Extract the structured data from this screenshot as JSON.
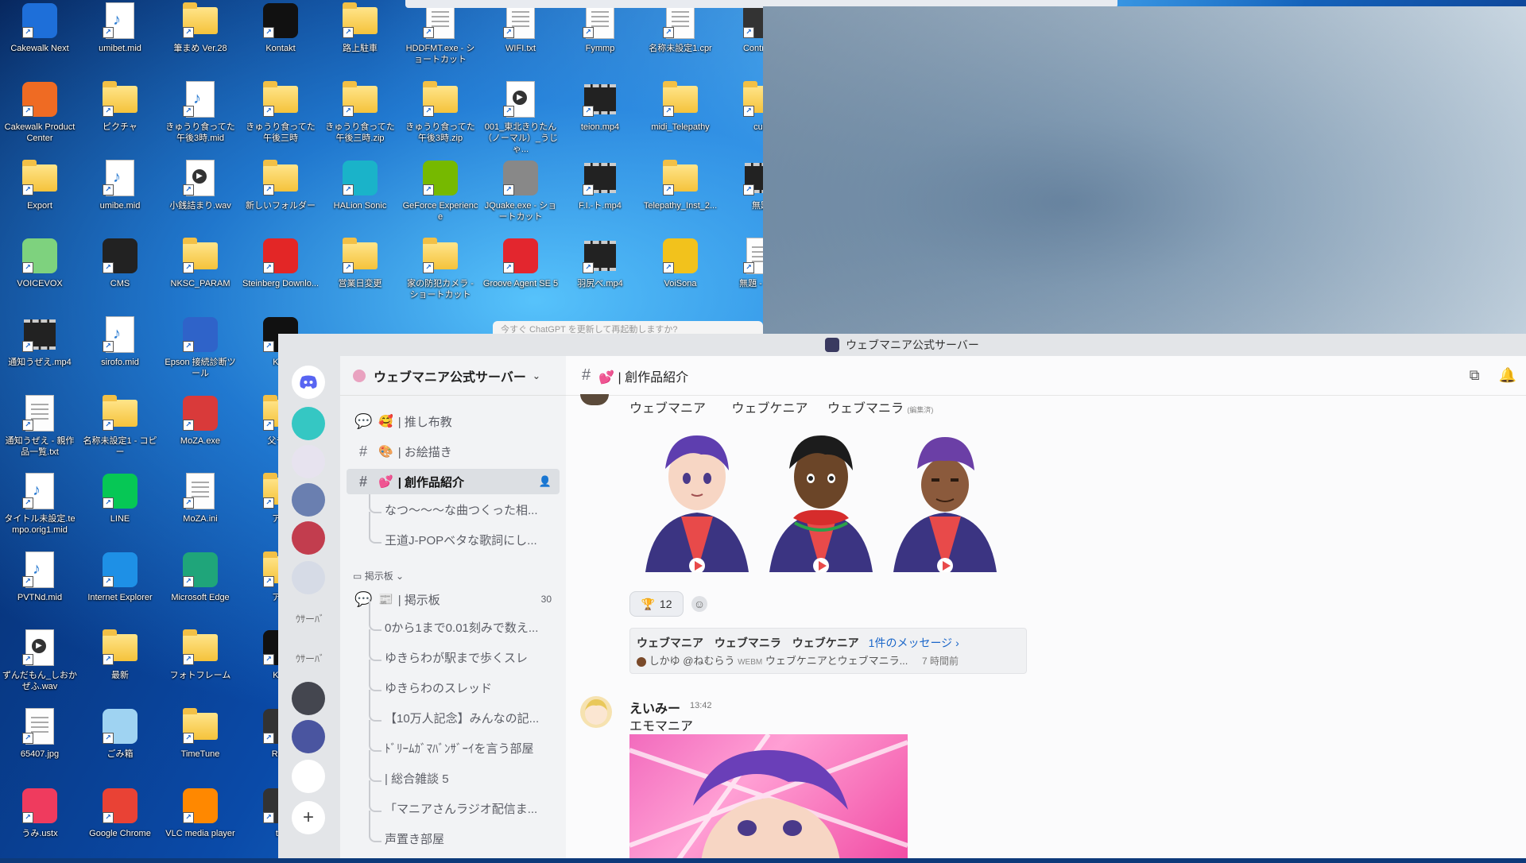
{
  "desktop": {
    "icons": [
      {
        "label": "Cakewalk Next",
        "kind": "app",
        "color": "#1e6fd9"
      },
      {
        "label": "umibet.mid",
        "kind": "midi"
      },
      {
        "label": "筆まめ Ver.28",
        "kind": "folder"
      },
      {
        "label": "Kontakt",
        "kind": "app",
        "color": "#111111"
      },
      {
        "label": "路上駐車",
        "kind": "folder"
      },
      {
        "label": "HDDFMT.exe - ショートカット",
        "kind": "doc"
      },
      {
        "label": "WIFI.txt",
        "kind": "doc"
      },
      {
        "label": "Fymmp",
        "kind": "doc"
      },
      {
        "label": "名称未設定1.cpr",
        "kind": "doc"
      },
      {
        "label": "Controlle",
        "kind": "app",
        "color": "#333333"
      },
      {
        "label": "Cakewalk Product Center",
        "kind": "app",
        "color": "#ef6b23"
      },
      {
        "label": "ピクチャ",
        "kind": "folder"
      },
      {
        "label": "きゅうり食ってた午後3時.mid",
        "kind": "midi"
      },
      {
        "label": "きゅうり食ってた午後三時",
        "kind": "folder"
      },
      {
        "label": "きゅうり食ってた午後三時.zip",
        "kind": "folder"
      },
      {
        "label": "きゅうり食ってた午後3時.zip",
        "kind": "folder"
      },
      {
        "label": "001_東北きりたん（ノーマル）_うじゃ...",
        "kind": "wav"
      },
      {
        "label": "teion.mp4",
        "kind": "video"
      },
      {
        "label": "midi_Telepathy",
        "kind": "folder"
      },
      {
        "label": "cub",
        "kind": "folder"
      },
      {
        "label": "Export",
        "kind": "folder"
      },
      {
        "label": "umibe.mid",
        "kind": "midi"
      },
      {
        "label": "小銭詰まり.wav",
        "kind": "wav"
      },
      {
        "label": "新しいフォルダー",
        "kind": "folder"
      },
      {
        "label": "HALion Sonic",
        "kind": "app",
        "color": "#1ab3c9"
      },
      {
        "label": "GeForce Experience",
        "kind": "app",
        "color": "#76b900"
      },
      {
        "label": "JQuake.exe - ショートカット",
        "kind": "app",
        "color": "#888888"
      },
      {
        "label": "F.I.-ト.mp4",
        "kind": "video"
      },
      {
        "label": "Telepathy_Inst_2...",
        "kind": "folder"
      },
      {
        "label": "無題",
        "kind": "video"
      },
      {
        "label": "VOICEVOX",
        "kind": "app",
        "color": "#7ed27e"
      },
      {
        "label": "CMS",
        "kind": "app",
        "color": "#222222"
      },
      {
        "label": "NKSC_PARAM",
        "kind": "folder"
      },
      {
        "label": "Steinberg Downlo...",
        "kind": "app",
        "color": "#e32626"
      },
      {
        "label": "営業日変更",
        "kind": "folder"
      },
      {
        "label": "家の防犯カメラ - ショートカット",
        "kind": "folder"
      },
      {
        "label": "Groove Agent SE 5",
        "kind": "app",
        "color": "#e3262e"
      },
      {
        "label": "羽尻べ.mp4",
        "kind": "video"
      },
      {
        "label": "VoiSona",
        "kind": "app",
        "color": "#f2c21c"
      },
      {
        "label": "無題 - 編覧",
        "kind": "doc"
      },
      {
        "label": "通知うぜえ.mp4",
        "kind": "video"
      },
      {
        "label": "sirofo.mid",
        "kind": "midi"
      },
      {
        "label": "Epson 接続診断ツール",
        "kind": "app",
        "color": "#2f63c9"
      },
      {
        "label": "Kon",
        "kind": "app",
        "color": "#111111"
      },
      {
        "label": "通知うぜえ - 親作品一覧.txt",
        "kind": "doc"
      },
      {
        "label": "名称未設定1 - コピー",
        "kind": "folder"
      },
      {
        "label": "MoZA.exe",
        "kind": "app",
        "color": "#d93a3a"
      },
      {
        "label": "父チキ",
        "kind": "folder"
      },
      {
        "label": "タイトル未設定.tempo.orig1.mid",
        "kind": "midi"
      },
      {
        "label": "LINE",
        "kind": "app",
        "color": "#06c755"
      },
      {
        "label": "MoZA.ini",
        "kind": "doc"
      },
      {
        "label": "アナ",
        "kind": "folder"
      },
      {
        "label": "PVTNd.mid",
        "kind": "midi"
      },
      {
        "label": "Internet Explorer",
        "kind": "app",
        "color": "#1e90e6"
      },
      {
        "label": "Microsoft Edge",
        "kind": "app",
        "color": "#1fa57a"
      },
      {
        "label": "アナ",
        "kind": "folder"
      },
      {
        "label": "ずんだもん_しおかぜふ.wav",
        "kind": "wav"
      },
      {
        "label": "最新",
        "kind": "folder"
      },
      {
        "label": "フォトフレーム",
        "kind": "folder"
      },
      {
        "label": "Kon",
        "kind": "app",
        "color": "#111111"
      },
      {
        "label": "65407.jpg",
        "kind": "doc"
      },
      {
        "label": "ごみ箱",
        "kind": "app",
        "color": "#9fd3f2"
      },
      {
        "label": "TimeTune",
        "kind": "folder"
      },
      {
        "label": "Real",
        "kind": "app",
        "color": "#333333"
      },
      {
        "label": "うみ.ustx",
        "kind": "app",
        "color": "#ef3b5e"
      },
      {
        "label": "Google Chrome",
        "kind": "app",
        "color": "#e94235"
      },
      {
        "label": "VLC media player",
        "kind": "app",
        "color": "#ff8800"
      },
      {
        "label": "td.",
        "kind": "app",
        "color": "#333333"
      }
    ]
  },
  "chatgpt_bar": {
    "text": "今すぐ ChatGPT を更新して再起動しますか?"
  },
  "discord": {
    "window_title": "ウェブマニア公式サーバー",
    "guild_labels": [
      "ｳｻーﾊﾞ",
      "ｳｻーﾊﾞ"
    ],
    "server_name": "ウェブマニア公式サーバー",
    "channels": [
      {
        "icon": "🥰",
        "label": "| 推し布教"
      },
      {
        "icon": "🎨",
        "label": "| お絵描き"
      },
      {
        "icon": "💕",
        "label": "| 創作品紹介"
      }
    ],
    "threads_top": [
      "なつ～～～な曲つくった相...",
      "王道J-POPベタな歌詞にし..."
    ],
    "category": "掲示板",
    "forum_channel": {
      "label": "| 掲示板",
      "count": "30"
    },
    "threads_forum": [
      "0から1まで0.01刻みで数え...",
      "ゆきらわが駅まで歩くスレ",
      "ゆきらわのスレッド",
      "【10万人記念】みんなの記...",
      "ﾄﾞﾘｰﾑｶﾞﾏﾊﾞﾝｻﾞｰｲを言う部屋",
      "| 総合雑談 5",
      "「マニアさんラジオ配信ま...",
      "声置き部屋"
    ],
    "chat_header": {
      "channel": "💕 | 創作品紹介"
    },
    "message1": {
      "names": [
        "ウェブマニア",
        "ウェブケニア",
        "ウェブマニラ"
      ],
      "edited": "(編集済)",
      "reaction_count": "12"
    },
    "thread_card": {
      "titles": [
        "ウェブマニア",
        "ウェブマニラ",
        "ウェブケニア"
      ],
      "link": "1件のメッセージ ›",
      "preview_author": "しかゆ",
      "preview_mention": "@ねむらう",
      "preview_tag": "WEBM",
      "preview_text": "ウェブケニアとウェブマニラ...",
      "time": "7 時間前"
    },
    "message2": {
      "author": "えいみー",
      "time": "13:42",
      "text": "エモマニア"
    }
  }
}
